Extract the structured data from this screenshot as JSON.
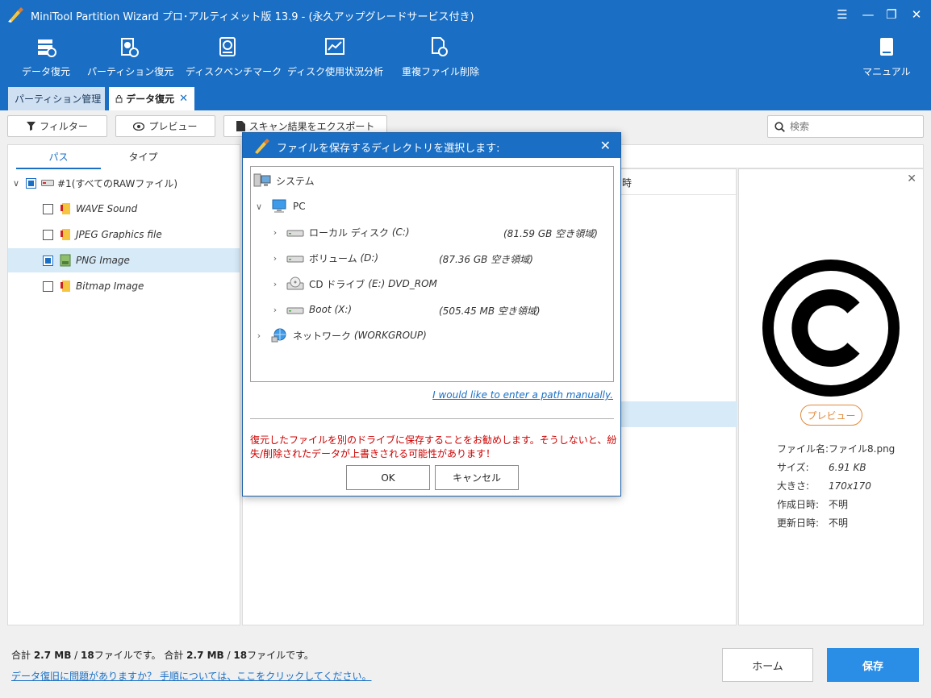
{
  "window": {
    "title": "MiniTool Partition Wizard プロ･アルティメット版 13.9 - (永久アップグレードサービス付き)"
  },
  "toolbar": [
    {
      "label": "データ復元",
      "icon": "data-recovery-icon"
    },
    {
      "label": "パーティション復元",
      "icon": "partition-recovery-icon"
    },
    {
      "label": "ディスクベンチマーク",
      "icon": "disk-benchmark-icon"
    },
    {
      "label": "ディスク使用状況分析",
      "icon": "space-analyzer-icon"
    },
    {
      "label": "重複ファイル削除",
      "icon": "duplicate-file-icon"
    }
  ],
  "manual": {
    "label": "マニュアル"
  },
  "tabs": {
    "management": "パーティション管理",
    "recovery": "データ復元"
  },
  "actions": {
    "filter": "フィルター",
    "preview": "プレビュー",
    "export": "スキャン結果をエクスポート",
    "search_placeholder": "検索"
  },
  "left_panel": {
    "tab_path": "パス",
    "tab_type": "タイプ",
    "root": "#1(すべてのRAWファイル)",
    "items": [
      {
        "label": "WAVE Sound",
        "checked": false
      },
      {
        "label": "JPEG Graphics file",
        "checked": false
      },
      {
        "label": "PNG Image",
        "checked": true
      },
      {
        "label": "Bitmap Image",
        "checked": false
      }
    ]
  },
  "middle_panel": {
    "col_fragment": "時"
  },
  "right_panel": {
    "preview_label": "プレビュー",
    "props": [
      {
        "key": "ファイル名:",
        "value": "ファイル8.png"
      },
      {
        "key": "サイズ:",
        "value": "6.91 KB"
      },
      {
        "key": "大きさ:",
        "value": "170x170"
      },
      {
        "key": "作成日時:",
        "value": "不明"
      },
      {
        "key": "更新日時:",
        "value": "不明"
      }
    ]
  },
  "status": {
    "prefix1": "合計 ",
    "size1": "2.7 MB",
    "sep1": " / ",
    "count1": "18",
    "suffix1": "ファイルです。 合計 ",
    "size2": "2.7 MB",
    "sep2": " / ",
    "count2": "18",
    "suffix2": "ファイルです。",
    "help": "データ復旧に問題がありますか？ 手順については、ここをクリックしてください。"
  },
  "buttons": {
    "home": "ホーム",
    "save": "保存"
  },
  "dialog": {
    "title": "ファイルを保存するディレクトリを選択します:",
    "tree": {
      "system": "システム",
      "pc": "PC",
      "drives": [
        {
          "name": "ローカル ディスク",
          "letter": "(C:)",
          "free": "(81.59 GB 空き領域)"
        },
        {
          "name": "ボリューム",
          "letter": "(D:)",
          "free": "(87.36 GB 空き領域)"
        },
        {
          "name": "CD ドライブ",
          "letter": "(E:) DVD_ROM",
          "free": ""
        },
        {
          "name": "Boot",
          "letter": "(X:)",
          "free": "(505.45 MB 空き領域)"
        }
      ],
      "network": "ネットワーク",
      "network_group": "(WORKGROUP)"
    },
    "manual_link": "I would like to enter a path manually.",
    "warning": "復元したファイルを別のドライブに保存することをお勧めします。そうしないと、紛失/削除されたデータが上書きされる可能性があります！",
    "ok": "OK",
    "cancel": "キャンセル"
  },
  "colors": {
    "header": "#1a6fc4",
    "accent": "#2a8ee6",
    "warning": "#cc0000",
    "preview_accent": "#e08a3c"
  }
}
